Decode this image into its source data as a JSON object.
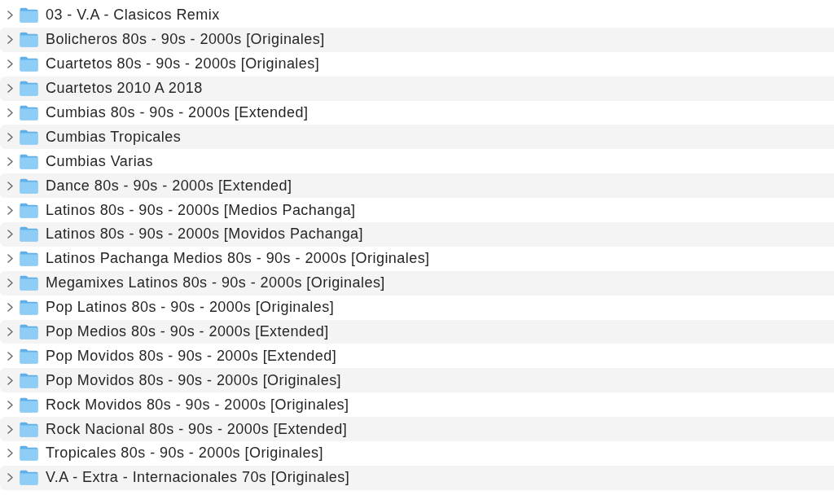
{
  "folders": [
    {
      "name": "03 - V.A - Clasicos Remix",
      "expanded": false
    },
    {
      "name": "Bolicheros 80s - 90s - 2000s [Originales]",
      "expanded": false
    },
    {
      "name": "Cuartetos 80s - 90s - 2000s [Originales]",
      "expanded": false
    },
    {
      "name": "Cuartetos 2010 A 2018",
      "expanded": false
    },
    {
      "name": "Cumbias 80s - 90s - 2000s [Extended]",
      "expanded": false
    },
    {
      "name": "Cumbias Tropicales",
      "expanded": false
    },
    {
      "name": "Cumbias Varias",
      "expanded": false
    },
    {
      "name": "Dance 80s - 90s - 2000s [Extended]",
      "expanded": false
    },
    {
      "name": "Latinos 80s - 90s - 2000s [Medios Pachanga]",
      "expanded": false
    },
    {
      "name": "Latinos 80s - 90s - 2000s [Movidos Pachanga]",
      "expanded": false
    },
    {
      "name": "Latinos Pachanga Medios 80s - 90s - 2000s [Originales]",
      "expanded": false
    },
    {
      "name": "Megamixes Latinos 80s - 90s - 2000s [Originales]",
      "expanded": false
    },
    {
      "name": "Pop Latinos 80s - 90s - 2000s [Originales]",
      "expanded": false
    },
    {
      "name": "Pop Medios 80s - 90s - 2000s [Extended]",
      "expanded": false
    },
    {
      "name": "Pop Movidos 80s - 90s - 2000s [Extended]",
      "expanded": false
    },
    {
      "name": "Pop Movidos 80s - 90s - 2000s [Originales]",
      "expanded": false
    },
    {
      "name": "Rock Movidos 80s - 90s - 2000s [Originales]",
      "expanded": false
    },
    {
      "name": "Rock Nacional 80s - 90s - 2000s [Extended]",
      "expanded": false
    },
    {
      "name": "Tropicales 80s - 90s - 2000s [Originales]",
      "expanded": false
    },
    {
      "name": "V.A - Extra - Internacionales 70s [Originales]",
      "expanded": false
    }
  ]
}
